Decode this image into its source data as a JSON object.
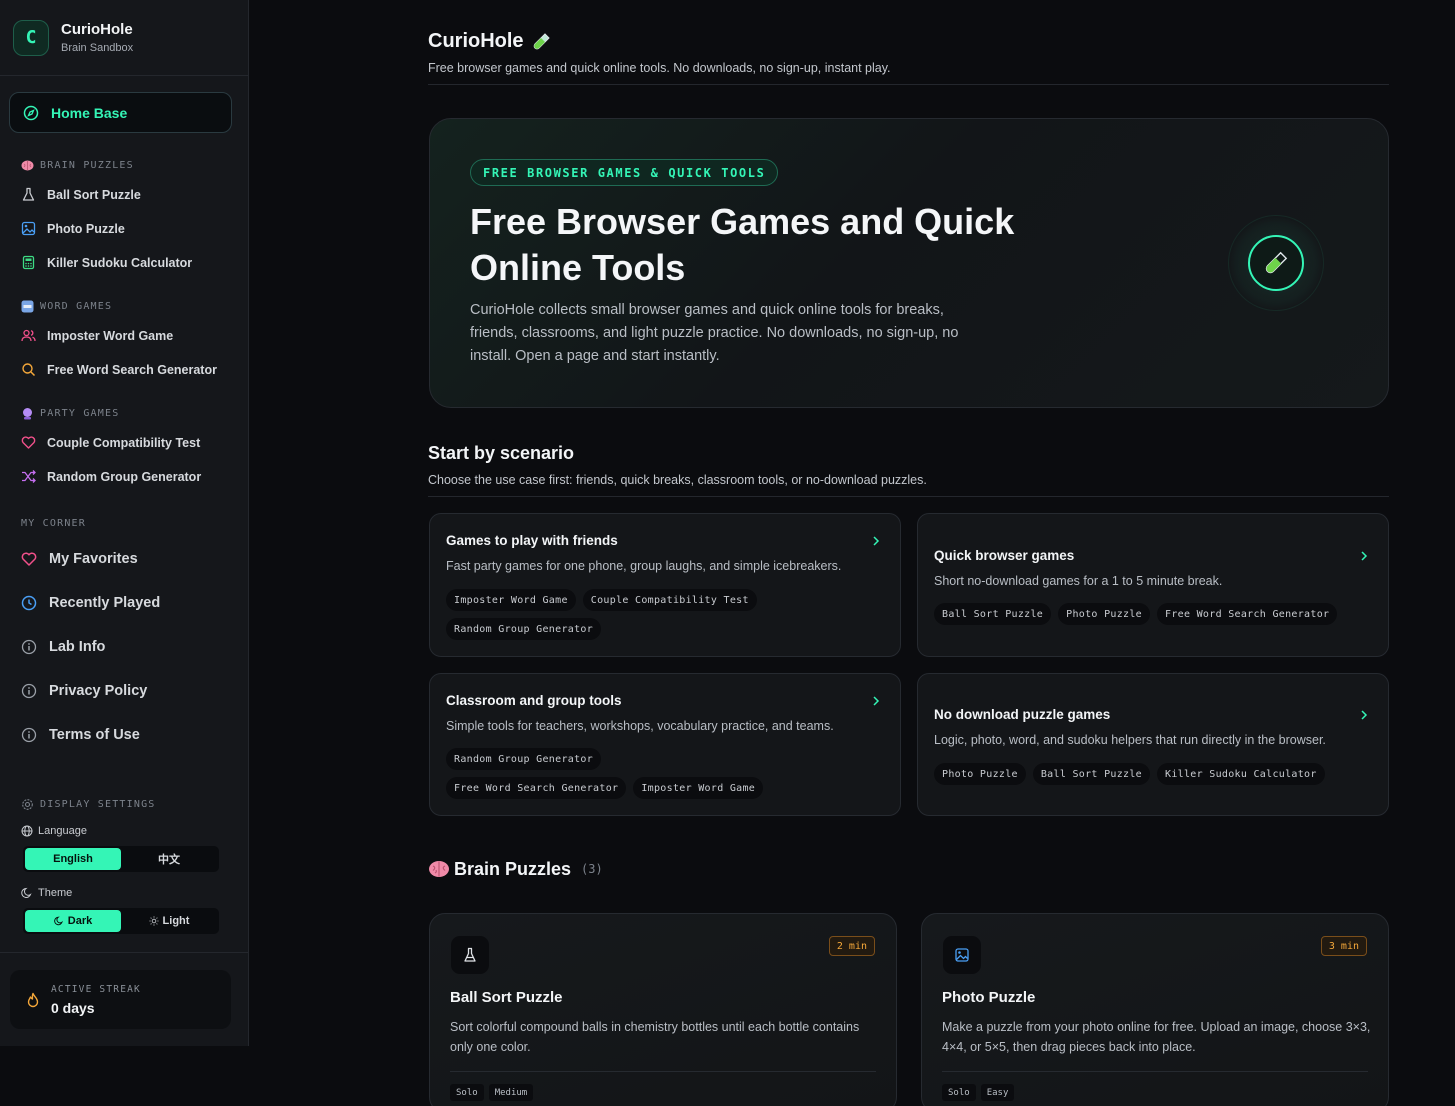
{
  "brand": {
    "letter": "C",
    "name": "CurioHole",
    "subtitle": "Brain Sandbox"
  },
  "sidebar": {
    "home": "Home Base",
    "sections": [
      {
        "title": "BRAIN PUZZLES",
        "items": [
          "Ball Sort Puzzle",
          "Photo Puzzle",
          "Killer Sudoku Calculator"
        ]
      },
      {
        "title": "WORD GAMES",
        "items": [
          "Imposter Word Game",
          "Free Word Search Generator"
        ]
      },
      {
        "title": "PARTY GAMES",
        "items": [
          "Couple Compatibility Test",
          "Random Group Generator"
        ]
      }
    ],
    "my_corner": {
      "title": "MY CORNER",
      "items": [
        "My Favorites",
        "Recently Played",
        "Lab Info",
        "Privacy Policy",
        "Terms of Use"
      ]
    },
    "display_settings": {
      "title": "DISPLAY SETTINGS",
      "language_label": "Language",
      "language_options": [
        "English",
        "中文"
      ],
      "language_selected": "English",
      "theme_label": "Theme",
      "theme_options": [
        "Dark",
        "Light"
      ],
      "theme_selected": "Dark"
    },
    "streak": {
      "label": "ACTIVE STREAK",
      "value": "0 days"
    }
  },
  "header": {
    "title": "CurioHole",
    "subtitle": "Free browser games and quick online tools. No downloads, no sign-up, instant play."
  },
  "hero": {
    "pill": "FREE BROWSER GAMES & QUICK TOOLS",
    "heading": "Free Browser Games and Quick Online Tools",
    "body": "CurioHole collects small browser games and quick online tools for breaks, friends, classrooms, and light puzzle practice. No downloads, no sign-up, no install. Open a page and start instantly."
  },
  "scenario": {
    "title": "Start by scenario",
    "subtitle": "Choose the use case first: friends, quick breaks, classroom tools, or no-download puzzles.",
    "cards": [
      {
        "title": "Games to play with friends",
        "desc": "Fast party games for one phone, group laughs, and simple icebreakers.",
        "tags": [
          "Imposter Word Game",
          "Couple Compatibility Test",
          "Random Group Generator"
        ]
      },
      {
        "title": "Quick browser games",
        "desc": "Short no-download games for a 1 to 5 minute break.",
        "tags": [
          "Ball Sort Puzzle",
          "Photo Puzzle",
          "Free Word Search Generator"
        ]
      },
      {
        "title": "Classroom and group tools",
        "desc": "Simple tools for teachers, workshops, vocabulary practice, and teams.",
        "tags": [
          "Random Group Generator",
          "Free Word Search Generator",
          "Imposter Word Game"
        ]
      },
      {
        "title": "No download puzzle games",
        "desc": "Logic, photo, word, and sudoku helpers that run directly in the browser.",
        "tags": [
          "Photo Puzzle",
          "Ball Sort Puzzle",
          "Killer Sudoku Calculator"
        ]
      }
    ]
  },
  "brain_puzzles": {
    "title": "Brain Puzzles",
    "count": "(3)",
    "games": [
      {
        "title": "Ball Sort Puzzle",
        "time": "2 min",
        "desc": "Sort colorful compound balls in chemistry bottles until each bottle contains only one color.",
        "tags": [
          "Solo",
          "Medium"
        ],
        "icon": "flask-icon"
      },
      {
        "title": "Photo Puzzle",
        "time": "3 min",
        "desc": "Make a puzzle from your photo online for free. Upload an image, choose 3×3, 4×4, or 5×5, then drag pieces back into place.",
        "tags": [
          "Solo",
          "Easy"
        ],
        "icon": "image-icon"
      }
    ]
  },
  "colors": {
    "accent": "#34f5b6",
    "background": "#0b0c0f",
    "sidebar": "#15171b",
    "time_badge": "#f5a83a"
  }
}
